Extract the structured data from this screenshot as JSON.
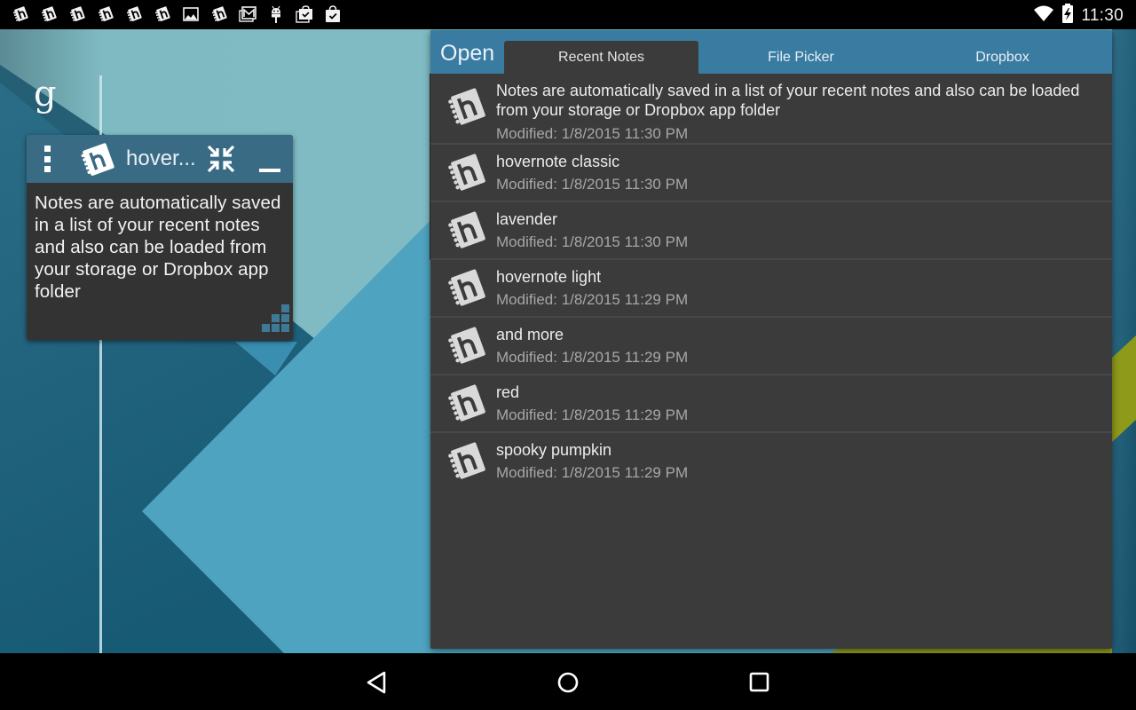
{
  "status_bar": {
    "notification_icons": [
      "hovernote-icon",
      "hovernote-icon",
      "hovernote-icon",
      "hovernote-icon",
      "hovernote-icon",
      "hovernote-icon",
      "gallery-icon",
      "hovernote-icon",
      "gmail-icon",
      "android-debug-icon",
      "play-store-update-icon",
      "play-store-done-icon"
    ],
    "wifi_icon": "wifi-icon",
    "battery_icon": "battery-charging-icon",
    "time": "11:30"
  },
  "home_screen": {
    "search_glyph": "g"
  },
  "note_widget": {
    "title": "hover...",
    "body": "Notes are automatically saved in a list of your recent notes and also can be loaded from your storage or Dropbox app folder",
    "menu_icon": "overflow-menu-icon",
    "collapse_icon": "collapse-arrows-icon",
    "minimize_icon": "minimize-icon",
    "resize_icon": "resize-grip-icon",
    "header_color": "#3a6b85"
  },
  "open_dialog": {
    "title": "Open",
    "accent_color": "#3a7ba1",
    "tabs": [
      {
        "label": "Recent Notes",
        "active": true
      },
      {
        "label": "File Picker",
        "active": false
      },
      {
        "label": "Dropbox",
        "active": false
      }
    ],
    "notes": [
      {
        "name": "Notes are automatically saved in a list of your recent notes and also can be loaded from your storage or Dropbox app folder",
        "modified": "Modified: 1/8/2015 11:30 PM"
      },
      {
        "name": "hovernote classic",
        "modified": "Modified: 1/8/2015 11:30 PM"
      },
      {
        "name": "lavender",
        "modified": "Modified: 1/8/2015 11:30 PM"
      },
      {
        "name": "hovernote light",
        "modified": "Modified: 1/8/2015 11:29 PM"
      },
      {
        "name": "and more",
        "modified": "Modified: 1/8/2015 11:29 PM"
      },
      {
        "name": "red",
        "modified": "Modified: 1/8/2015 11:29 PM"
      },
      {
        "name": "spooky pumpkin",
        "modified": "Modified: 1/8/2015 11:29 PM"
      }
    ]
  },
  "nav_bar": {
    "back": "back-icon",
    "home": "home-icon",
    "recents": "recents-icon"
  }
}
